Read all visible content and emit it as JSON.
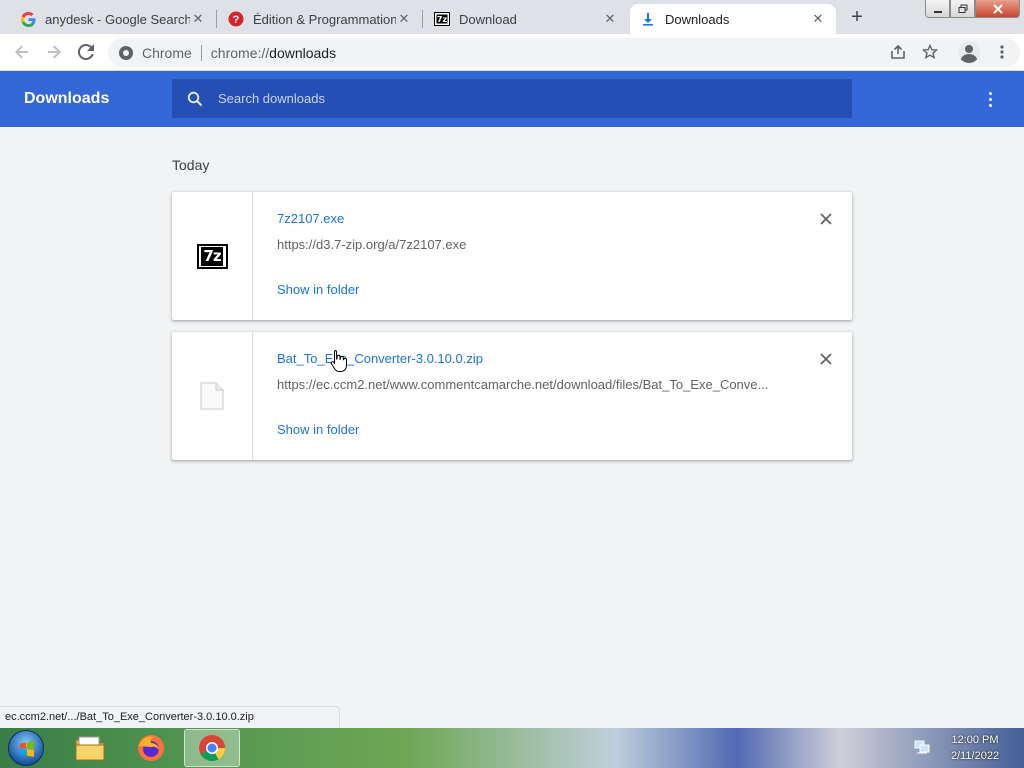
{
  "browser": {
    "tabs": [
      {
        "title": "anydesk - Google Search",
        "favicon": "google-icon",
        "active": false
      },
      {
        "title": "Édition & Programmation",
        "favicon": "ccm-icon",
        "active": false
      },
      {
        "title": "Download",
        "favicon": "7zip-icon",
        "active": false
      },
      {
        "title": "Downloads",
        "favicon": "download-icon",
        "active": true
      }
    ],
    "close_glyph": "✕",
    "new_tab_glyph": "+",
    "omnibox": {
      "chip": "Chrome",
      "url_scheme": "chrome://",
      "url_host": "downloads"
    }
  },
  "downloads_page": {
    "title": "Downloads",
    "search_placeholder": "Search downloads",
    "section_label": "Today",
    "items": [
      {
        "filename": "7z2107.exe",
        "url": "https://d3.7-zip.org/a/7z2107.exe",
        "action": "Show in folder",
        "icon": "7zip-icon",
        "icon_text": "7z"
      },
      {
        "filename": "Bat_To_Exe_Converter-3.0.10.0.zip",
        "url": "https://ec.ccm2.net/www.commentcamarche.net/download/files/Bat_To_Exe_Conve...",
        "action": "Show in folder",
        "icon": "file-icon"
      }
    ]
  },
  "status_bar": {
    "text": "ec.ccm2.net/.../Bat_To_Exe_Converter-3.0.10.0.zip"
  },
  "taskbar": {
    "apps": [
      "windows-explorer-icon",
      "firefox-icon",
      "chrome-icon"
    ],
    "active_app": "chrome-icon",
    "time": "12:00 PM",
    "date": "2/11/2022"
  },
  "colors": {
    "header_blue": "#3367d6",
    "search_blue": "#254fb4",
    "link_blue": "#1a73e8",
    "page_bg": "#f1f3f4"
  }
}
